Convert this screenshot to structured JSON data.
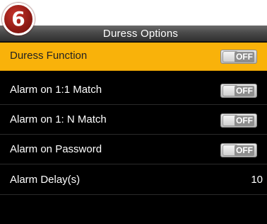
{
  "step_badge": "6",
  "header": {
    "title": "Duress Options"
  },
  "rows": [
    {
      "label": "Duress Function",
      "toggle": "OFF",
      "selected": true
    },
    {
      "label": "Alarm on 1:1 Match",
      "toggle": "OFF",
      "selected": false
    },
    {
      "label": "Alarm on 1: N Match",
      "toggle": "OFF",
      "selected": false
    },
    {
      "label": "Alarm on Password",
      "toggle": "OFF",
      "selected": false
    },
    {
      "label": "Alarm Delay(s)",
      "value": "10",
      "selected": false
    }
  ],
  "colors": {
    "selected_row": "#f9b20a",
    "background": "#000000",
    "badge": "#a3231b"
  },
  "icons": {
    "toggle": "off-toggle-switch"
  }
}
